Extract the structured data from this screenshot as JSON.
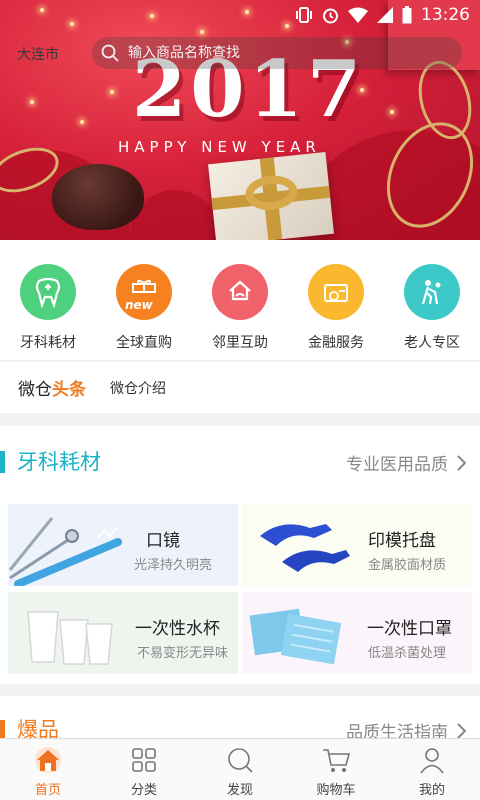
{
  "status_bar": {
    "time": "13:26"
  },
  "header": {
    "location": "大连市",
    "search_placeholder": "输入商品名称查找"
  },
  "banner": {
    "year": "2017",
    "greeting": "HAPPY NEW YEAR"
  },
  "quick_nav": [
    {
      "label": "牙科耗材",
      "icon": "tooth-icon",
      "color": "#4fd07f"
    },
    {
      "label": "全球直购",
      "icon": "gift-new-icon",
      "color": "#f5821f",
      "badge": "new"
    },
    {
      "label": "邻里互助",
      "icon": "home-hands-icon",
      "color": "#f0636a"
    },
    {
      "label": "金融服务",
      "icon": "wallet-icon",
      "color": "#f9b82d"
    },
    {
      "label": "老人专区",
      "icon": "elderly-icon",
      "color": "#3ec9c9"
    }
  ],
  "headlines": {
    "brand_prefix": "微仓",
    "brand_hot": "头条",
    "text": "微仓介绍"
  },
  "dental_section": {
    "title": "牙科耗材",
    "more": "专业医用品质",
    "accent": "#1bb4c8",
    "products": [
      {
        "name": "口镜",
        "desc": "光泽持久明亮"
      },
      {
        "name": "印模托盘",
        "desc": "金属胶面材质"
      },
      {
        "name": "一次性水杯",
        "desc": "不易变形无异味"
      },
      {
        "name": "一次性口罩",
        "desc": "低温杀菌处理"
      }
    ]
  },
  "hot_section": {
    "title": "爆品",
    "more": "品质生活指南",
    "accent": "#f07a1e"
  },
  "bottom_nav": [
    {
      "label": "首页",
      "icon": "home-icon",
      "active": true
    },
    {
      "label": "分类",
      "icon": "category-icon",
      "active": false
    },
    {
      "label": "发现",
      "icon": "discover-icon",
      "active": false
    },
    {
      "label": "购物车",
      "icon": "cart-icon",
      "active": false
    },
    {
      "label": "我的",
      "icon": "profile-icon",
      "active": false
    }
  ],
  "colors": {
    "active_nav": "#ef6f23",
    "banner_red": "#d6213a"
  }
}
